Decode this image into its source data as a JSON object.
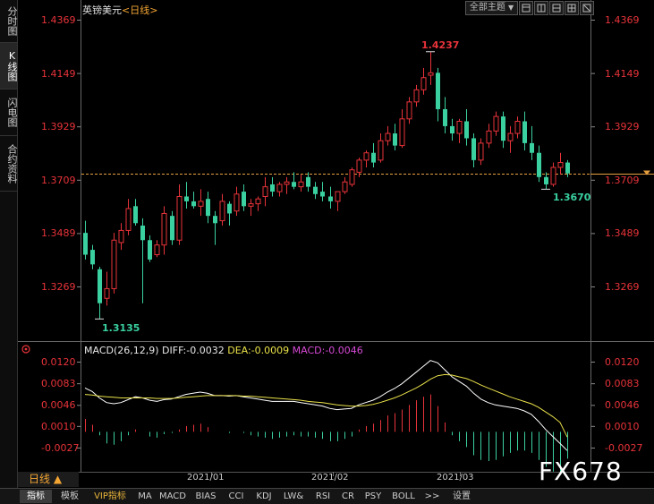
{
  "sidebar": {
    "tabs": [
      {
        "label": "分时图",
        "active": false
      },
      {
        "label": "K线图",
        "active": true
      },
      {
        "label": "闪电图",
        "active": false
      },
      {
        "label": "合约资料",
        "active": false
      }
    ]
  },
  "header": {
    "symbol": "英镑美元",
    "period_label": "<日线>",
    "theme_button": "全部主题",
    "theme_arrow": "▼"
  },
  "price_axis": {
    "labels": [
      "1.4369",
      "1.4149",
      "1.3929",
      "1.3709",
      "1.3489",
      "1.3269"
    ],
    "label_color": "#e8333a"
  },
  "macd_axis": {
    "labels": [
      "0.0120",
      "0.0083",
      "0.0046",
      "0.0010",
      "-0.0027"
    ]
  },
  "annotations": {
    "high": "1.4237",
    "low_left": "1.3135",
    "low_right": "1.3670"
  },
  "macd_header": {
    "name": "MACD(26,12,9)",
    "diff": "DIFF:-0.0032",
    "dea": "DEA:-0.0009",
    "macd": "MACD:-0.0046"
  },
  "date_axis": [
    "2021/01",
    "2021/02",
    "2021/03"
  ],
  "period_selector": "日线 ▲",
  "bottom_tabs": [
    "指标",
    "模板",
    "VIP指标",
    "MA",
    "MACD",
    "BIAS",
    "CCI",
    "KDJ",
    "LW&",
    "RSI",
    "CR",
    "PSY",
    "BOLL",
    ">>",
    "设置"
  ],
  "watermark": "FX678",
  "colors": {
    "up": "#e8333a",
    "down": "#3ad0a0",
    "dashed": "#e8a040",
    "diff": "#ffffff",
    "dea": "#e9e14a"
  },
  "chart_data": {
    "type": "candlestick",
    "title": "英镑美元 日线",
    "y_range": [
      1.31,
      1.44
    ],
    "current_price": 1.3735,
    "annotated_high": 1.4237,
    "annotated_low": 1.3135,
    "candles": [
      {
        "o": 1.349,
        "h": 1.354,
        "l": 1.338,
        "c": 1.34
      },
      {
        "o": 1.342,
        "h": 1.344,
        "l": 1.334,
        "c": 1.336
      },
      {
        "o": 1.334,
        "h": 1.335,
        "l": 1.3135,
        "c": 1.32
      },
      {
        "o": 1.322,
        "h": 1.333,
        "l": 1.319,
        "c": 1.326
      },
      {
        "o": 1.326,
        "h": 1.349,
        "l": 1.324,
        "c": 1.346
      },
      {
        "o": 1.345,
        "h": 1.353,
        "l": 1.342,
        "c": 1.35
      },
      {
        "o": 1.35,
        "h": 1.363,
        "l": 1.348,
        "c": 1.359
      },
      {
        "o": 1.36,
        "h": 1.363,
        "l": 1.352,
        "c": 1.353
      },
      {
        "o": 1.352,
        "h": 1.355,
        "l": 1.32,
        "c": 1.346
      },
      {
        "o": 1.346,
        "h": 1.348,
        "l": 1.337,
        "c": 1.338
      },
      {
        "o": 1.34,
        "h": 1.346,
        "l": 1.339,
        "c": 1.344
      },
      {
        "o": 1.344,
        "h": 1.36,
        "l": 1.34,
        "c": 1.357
      },
      {
        "o": 1.356,
        "h": 1.358,
        "l": 1.344,
        "c": 1.346
      },
      {
        "o": 1.346,
        "h": 1.369,
        "l": 1.344,
        "c": 1.364
      },
      {
        "o": 1.364,
        "h": 1.37,
        "l": 1.359,
        "c": 1.362
      },
      {
        "o": 1.362,
        "h": 1.366,
        "l": 1.359,
        "c": 1.36
      },
      {
        "o": 1.36,
        "h": 1.367,
        "l": 1.356,
        "c": 1.362
      },
      {
        "o": 1.363,
        "h": 1.366,
        "l": 1.353,
        "c": 1.356
      },
      {
        "o": 1.356,
        "h": 1.358,
        "l": 1.344,
        "c": 1.353
      },
      {
        "o": 1.354,
        "h": 1.365,
        "l": 1.352,
        "c": 1.362
      },
      {
        "o": 1.361,
        "h": 1.362,
        "l": 1.352,
        "c": 1.357
      },
      {
        "o": 1.358,
        "h": 1.368,
        "l": 1.356,
        "c": 1.365
      },
      {
        "o": 1.366,
        "h": 1.369,
        "l": 1.358,
        "c": 1.36
      },
      {
        "o": 1.36,
        "h": 1.363,
        "l": 1.356,
        "c": 1.361
      },
      {
        "o": 1.361,
        "h": 1.364,
        "l": 1.358,
        "c": 1.363
      },
      {
        "o": 1.364,
        "h": 1.372,
        "l": 1.36,
        "c": 1.368
      },
      {
        "o": 1.369,
        "h": 1.372,
        "l": 1.364,
        "c": 1.366
      },
      {
        "o": 1.366,
        "h": 1.37,
        "l": 1.364,
        "c": 1.369
      },
      {
        "o": 1.369,
        "h": 1.372,
        "l": 1.365,
        "c": 1.37
      },
      {
        "o": 1.37,
        "h": 1.374,
        "l": 1.367,
        "c": 1.368
      },
      {
        "o": 1.368,
        "h": 1.373,
        "l": 1.366,
        "c": 1.37
      },
      {
        "o": 1.372,
        "h": 1.374,
        "l": 1.366,
        "c": 1.368
      },
      {
        "o": 1.368,
        "h": 1.37,
        "l": 1.363,
        "c": 1.365
      },
      {
        "o": 1.366,
        "h": 1.37,
        "l": 1.362,
        "c": 1.364
      },
      {
        "o": 1.364,
        "h": 1.368,
        "l": 1.359,
        "c": 1.362
      },
      {
        "o": 1.362,
        "h": 1.366,
        "l": 1.358,
        "c": 1.366
      },
      {
        "o": 1.366,
        "h": 1.372,
        "l": 1.365,
        "c": 1.37
      },
      {
        "o": 1.369,
        "h": 1.376,
        "l": 1.368,
        "c": 1.375
      },
      {
        "o": 1.374,
        "h": 1.38,
        "l": 1.372,
        "c": 1.379
      },
      {
        "o": 1.379,
        "h": 1.383,
        "l": 1.376,
        "c": 1.382
      },
      {
        "o": 1.382,
        "h": 1.386,
        "l": 1.376,
        "c": 1.378
      },
      {
        "o": 1.379,
        "h": 1.39,
        "l": 1.378,
        "c": 1.387
      },
      {
        "o": 1.387,
        "h": 1.393,
        "l": 1.385,
        "c": 1.39
      },
      {
        "o": 1.39,
        "h": 1.394,
        "l": 1.383,
        "c": 1.385
      },
      {
        "o": 1.385,
        "h": 1.4,
        "l": 1.384,
        "c": 1.396
      },
      {
        "o": 1.396,
        "h": 1.405,
        "l": 1.394,
        "c": 1.403
      },
      {
        "o": 1.403,
        "h": 1.41,
        "l": 1.401,
        "c": 1.408
      },
      {
        "o": 1.408,
        "h": 1.417,
        "l": 1.406,
        "c": 1.413
      },
      {
        "o": 1.414,
        "h": 1.4237,
        "l": 1.41,
        "c": 1.415
      },
      {
        "o": 1.415,
        "h": 1.417,
        "l": 1.395,
        "c": 1.4
      },
      {
        "o": 1.4,
        "h": 1.405,
        "l": 1.39,
        "c": 1.393
      },
      {
        "o": 1.393,
        "h": 1.396,
        "l": 1.387,
        "c": 1.39
      },
      {
        "o": 1.39,
        "h": 1.396,
        "l": 1.386,
        "c": 1.395
      },
      {
        "o": 1.395,
        "h": 1.4,
        "l": 1.385,
        "c": 1.388
      },
      {
        "o": 1.388,
        "h": 1.39,
        "l": 1.376,
        "c": 1.379
      },
      {
        "o": 1.379,
        "h": 1.388,
        "l": 1.377,
        "c": 1.386
      },
      {
        "o": 1.386,
        "h": 1.394,
        "l": 1.384,
        "c": 1.391
      },
      {
        "o": 1.391,
        "h": 1.399,
        "l": 1.389,
        "c": 1.397
      },
      {
        "o": 1.397,
        "h": 1.399,
        "l": 1.384,
        "c": 1.387
      },
      {
        "o": 1.387,
        "h": 1.393,
        "l": 1.382,
        "c": 1.39
      },
      {
        "o": 1.39,
        "h": 1.397,
        "l": 1.388,
        "c": 1.395
      },
      {
        "o": 1.395,
        "h": 1.399,
        "l": 1.383,
        "c": 1.386
      },
      {
        "o": 1.386,
        "h": 1.393,
        "l": 1.379,
        "c": 1.382
      },
      {
        "o": 1.382,
        "h": 1.385,
        "l": 1.37,
        "c": 1.372
      },
      {
        "o": 1.372,
        "h": 1.374,
        "l": 1.367,
        "c": 1.369
      },
      {
        "o": 1.369,
        "h": 1.378,
        "l": 1.368,
        "c": 1.376
      },
      {
        "o": 1.376,
        "h": 1.382,
        "l": 1.373,
        "c": 1.378
      },
      {
        "o": 1.378,
        "h": 1.379,
        "l": 1.372,
        "c": 1.3735
      }
    ],
    "macd": {
      "diff": [
        0.0075,
        0.0069,
        0.0058,
        0.005,
        0.0048,
        0.005,
        0.0055,
        0.006,
        0.0058,
        0.0054,
        0.0052,
        0.0055,
        0.0056,
        0.006,
        0.0064,
        0.0066,
        0.0068,
        0.0066,
        0.0062,
        0.0062,
        0.0061,
        0.0062,
        0.006,
        0.0058,
        0.0056,
        0.0054,
        0.0052,
        0.0052,
        0.0052,
        0.0052,
        0.005,
        0.0048,
        0.0046,
        0.0044,
        0.004,
        0.0038,
        0.0039,
        0.004,
        0.0046,
        0.005,
        0.0054,
        0.006,
        0.0068,
        0.0074,
        0.0082,
        0.0092,
        0.0102,
        0.0112,
        0.0122,
        0.0118,
        0.0106,
        0.0094,
        0.0086,
        0.0078,
        0.0066,
        0.0056,
        0.005,
        0.0046,
        0.0044,
        0.0042,
        0.004,
        0.0036,
        0.003,
        0.0018,
        0.0004,
        -0.0008,
        -0.002,
        -0.0032
      ],
      "dea": [
        0.0064,
        0.0063,
        0.0061,
        0.006,
        0.0059,
        0.0058,
        0.0058,
        0.0058,
        0.0058,
        0.0058,
        0.0057,
        0.0057,
        0.0057,
        0.0058,
        0.0059,
        0.006,
        0.0061,
        0.0062,
        0.0062,
        0.0062,
        0.0062,
        0.0062,
        0.0061,
        0.0061,
        0.006,
        0.0059,
        0.0058,
        0.0057,
        0.0056,
        0.0055,
        0.0054,
        0.0052,
        0.0051,
        0.005,
        0.0048,
        0.0046,
        0.0045,
        0.0044,
        0.0044,
        0.0045,
        0.0047,
        0.005,
        0.0054,
        0.0058,
        0.0063,
        0.0069,
        0.0075,
        0.0082,
        0.009,
        0.0096,
        0.0098,
        0.0097,
        0.0094,
        0.0091,
        0.0086,
        0.008,
        0.0075,
        0.007,
        0.0065,
        0.006,
        0.0056,
        0.0052,
        0.0048,
        0.0042,
        0.0034,
        0.0026,
        0.0016,
        -0.0009
      ],
      "hist": [
        0.0022,
        0.0012,
        -0.0006,
        -0.002,
        -0.0022,
        -0.0016,
        -0.0006,
        0.0004,
        0.0,
        -0.0008,
        -0.001,
        -0.0004,
        -0.0002,
        0.0004,
        0.001,
        0.0012,
        0.0014,
        0.0008,
        0.0,
        0.0,
        -0.0002,
        0.0,
        -0.0002,
        -0.0006,
        -0.0008,
        -0.001,
        -0.0012,
        -0.001,
        -0.0008,
        -0.0006,
        -0.0008,
        -0.0008,
        -0.001,
        -0.0012,
        -0.0016,
        -0.0016,
        -0.0012,
        -0.0008,
        0.0004,
        0.001,
        0.0014,
        0.002,
        0.0028,
        0.0032,
        0.0038,
        0.0046,
        0.0054,
        0.006,
        0.0064,
        0.0044,
        0.0016,
        -0.0006,
        -0.0016,
        -0.0026,
        -0.004,
        -0.0048,
        -0.005,
        -0.0048,
        -0.0042,
        -0.0036,
        -0.0032,
        -0.0032,
        -0.0036,
        -0.0048,
        -0.006,
        -0.0068,
        -0.0072,
        -0.0046
      ]
    }
  }
}
